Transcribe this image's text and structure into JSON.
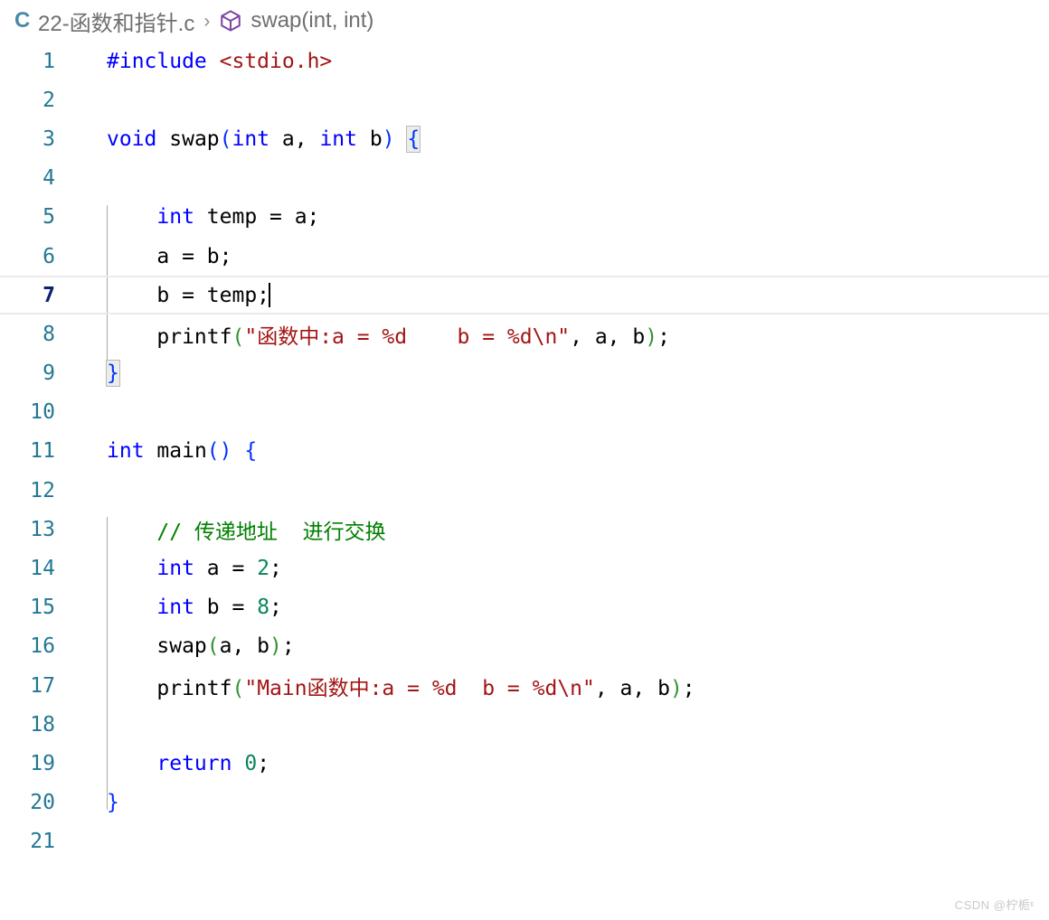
{
  "breadcrumb": {
    "file_icon": "c-file-icon",
    "file_icon_letter": "C",
    "file_name": "22-函数和指针.c",
    "separator": "›",
    "symbol_icon": "cube-symbol-icon",
    "symbol_name": "swap(int, int)"
  },
  "editor": {
    "language": "c",
    "active_line": 7,
    "cursor": {
      "line": 7,
      "column": 15
    },
    "total_lines": 21,
    "colors": {
      "background": "#ffffff",
      "line_number": "#237893",
      "active_line_number": "#0b216f",
      "active_line_border": "#eaeaea",
      "keyword": "#0000ff",
      "string": "#a31515",
      "comment": "#008000",
      "number": "#098658",
      "bracket_level1": "#0431fa",
      "bracket_level2": "#319331",
      "indent_guide": "#a9a9a9",
      "bracket_match_bg": "#e9eee9",
      "bracket_match_border": "#b9b9b9"
    },
    "lines": [
      {
        "n": "1",
        "text": "#include <stdio.h>"
      },
      {
        "n": "2",
        "text": ""
      },
      {
        "n": "3",
        "text": "void swap(int a, int b) {"
      },
      {
        "n": "4",
        "text": ""
      },
      {
        "n": "5",
        "text": "    int temp = a;"
      },
      {
        "n": "6",
        "text": "    a = b;"
      },
      {
        "n": "7",
        "text": "    b = temp;"
      },
      {
        "n": "8",
        "text": "    printf(\"函数中:a = %d    b = %d\\n\", a, b);"
      },
      {
        "n": "9",
        "text": "}"
      },
      {
        "n": "10",
        "text": ""
      },
      {
        "n": "11",
        "text": "int main() {"
      },
      {
        "n": "12",
        "text": ""
      },
      {
        "n": "13",
        "text": "    // 传递地址  进行交换"
      },
      {
        "n": "14",
        "text": "    int a = 2;"
      },
      {
        "n": "15",
        "text": "    int b = 8;"
      },
      {
        "n": "16",
        "text": "    swap(a, b);"
      },
      {
        "n": "17",
        "text": "    printf(\"Main函数中:a = %d  b = %d\\n\", a, b);"
      },
      {
        "n": "18",
        "text": ""
      },
      {
        "n": "19",
        "text": "    return 0;"
      },
      {
        "n": "20",
        "text": "}"
      },
      {
        "n": "21",
        "text": ""
      }
    ],
    "tokens": {
      "l1_include": "#include",
      "l1_space": " ",
      "l1_header": "<stdio.h>",
      "l3_void": "void",
      "l3_sp1": " ",
      "l3_swap": "swap",
      "l3_paren_open": "(",
      "l3_int1": "int",
      "l3_a": " a, ",
      "l3_int2": "int",
      "l3_b": " b",
      "l3_paren_close": ")",
      "l3_sp2": " ",
      "l3_brace": "{",
      "l5_int": "int",
      "l5_rest": " temp = a;",
      "l6_text": "a = b;",
      "l7_text": "b = temp;",
      "l8_printf": "printf",
      "l8_paren_open": "(",
      "l8_string": "\"函数中:a = %d    b = %d\\n\"",
      "l8_args": ", a, b",
      "l8_paren_close": ")",
      "l8_semi": ";",
      "l9_brace": "}",
      "l11_int": "int",
      "l11_sp": " ",
      "l11_main": "main",
      "l11_parens": "()",
      "l11_sp2": " ",
      "l11_brace": "{",
      "l13_comment": "// 传递地址  进行交换",
      "l14_int": "int",
      "l14_mid": " a = ",
      "l14_num": "2",
      "l14_semi": ";",
      "l15_int": "int",
      "l15_mid": " b = ",
      "l15_num": "8",
      "l15_semi": ";",
      "l16_swap": "swap",
      "l16_paren_open": "(",
      "l16_args": "a, b",
      "l16_paren_close": ")",
      "l16_semi": ";",
      "l17_printf": "printf",
      "l17_paren_open": "(",
      "l17_string": "\"Main函数中:a = %d  b = %d\\n\"",
      "l17_args": ", a, b",
      "l17_paren_close": ")",
      "l17_semi": ";",
      "l19_return": "return",
      "l19_sp": " ",
      "l19_num": "0",
      "l19_semi": ";",
      "l20_brace": "}"
    }
  },
  "watermark": {
    "text": "CSDN @柠栀ᵋ"
  }
}
